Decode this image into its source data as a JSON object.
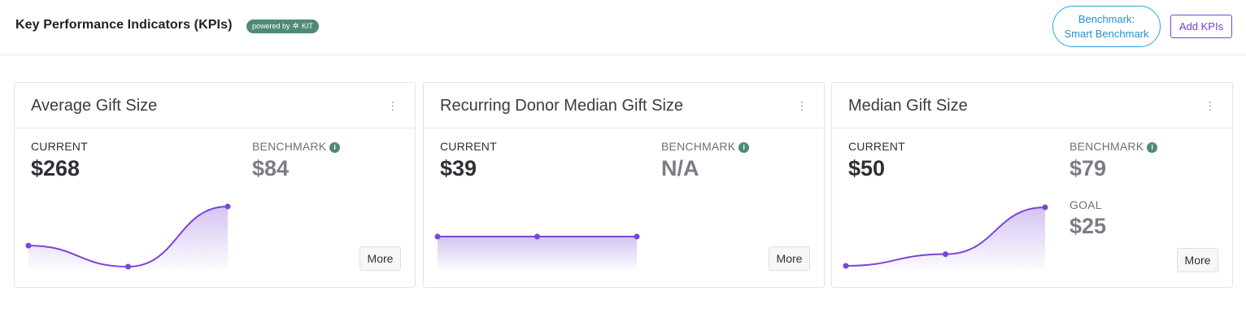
{
  "header": {
    "title": "Key Performance Indicators (KPIs)",
    "powered_by": "powered by",
    "powered_brand": "KIT",
    "benchmark_line1": "Benchmark:",
    "benchmark_line2": "Smart Benchmark",
    "add_kpis": "Add KPIs"
  },
  "colors": {
    "accent_purple": "#7b45d8",
    "benchmark_blue": "#2aa3e8",
    "kit_green": "#4f8a73"
  },
  "cards": [
    {
      "title": "Average Gift Size",
      "current_label": "CURRENT",
      "current_value": "$268",
      "benchmark_label": "BENCHMARK",
      "benchmark_value": "$84",
      "more": "More",
      "trend": [
        0.35,
        0.0,
        1.0
      ]
    },
    {
      "title": "Recurring Donor Median Gift Size",
      "current_label": "CURRENT",
      "current_value": "$39",
      "benchmark_label": "BENCHMARK",
      "benchmark_value": "N/A",
      "more": "More",
      "trend": [
        1.0,
        1.0,
        1.0
      ]
    },
    {
      "title": "Median Gift Size",
      "current_label": "CURRENT",
      "current_value": "$50",
      "benchmark_label": "BENCHMARK",
      "benchmark_value": "$79",
      "goal_label": "GOAL",
      "goal_value": "$25",
      "more": "More",
      "trend": [
        0.0,
        0.2,
        1.0
      ]
    }
  ]
}
